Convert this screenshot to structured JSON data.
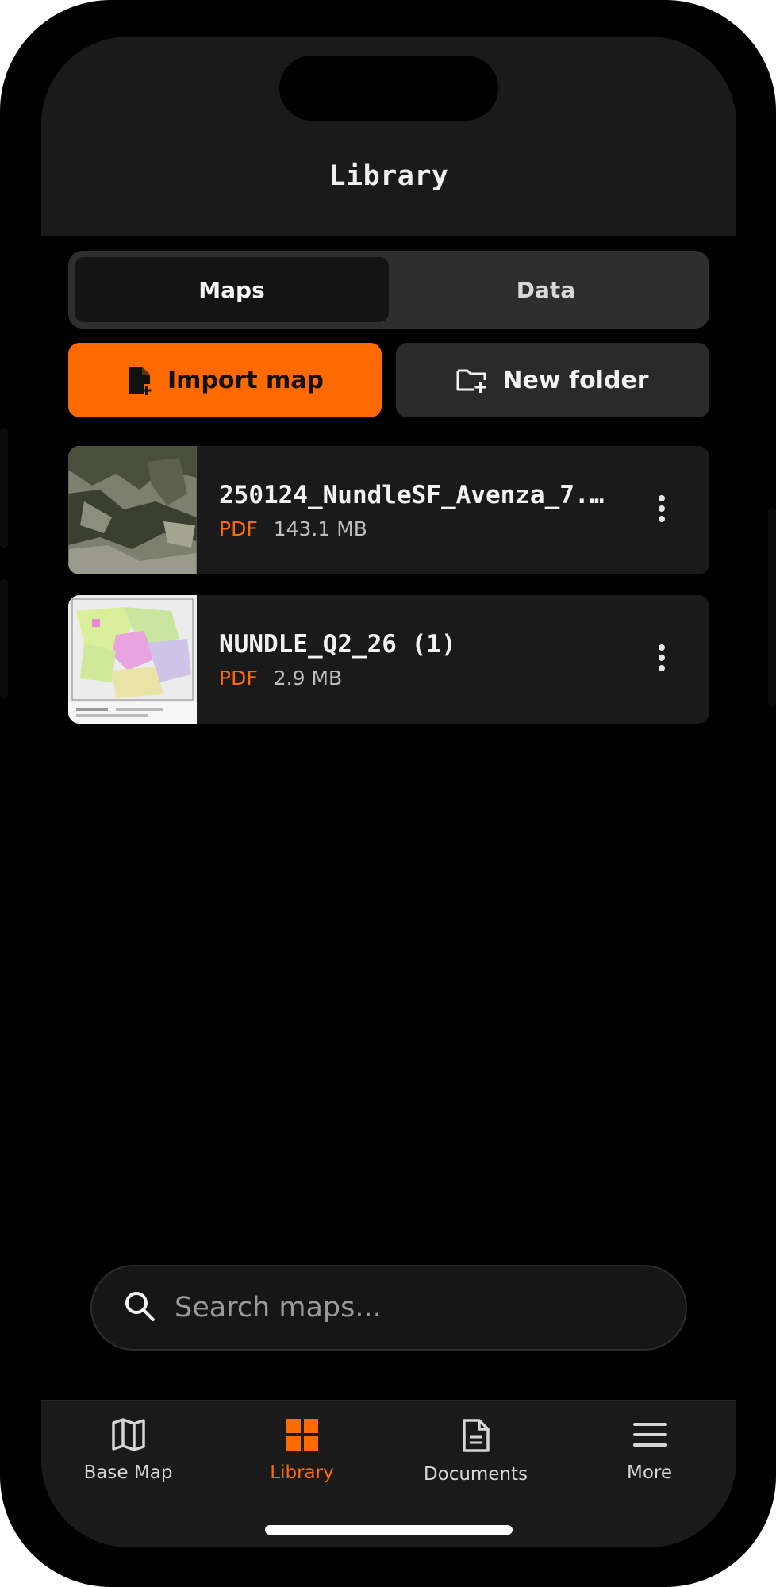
{
  "header": {
    "title": "Library"
  },
  "segments": [
    {
      "label": "Maps",
      "active": true
    },
    {
      "label": "Data",
      "active": false
    }
  ],
  "actions": {
    "import_label": "Import map",
    "new_folder_label": "New folder"
  },
  "maps": [
    {
      "name": "250124_NundleSF_Avenza_7...",
      "type": "PDF",
      "size": "143.1 MB",
      "thumbnail": "satellite-map-thumbnail"
    },
    {
      "name": "NUNDLE_Q2_26 (1)",
      "type": "PDF",
      "size": "2.9 MB",
      "thumbnail": "color-zoned-map-thumbnail"
    }
  ],
  "search": {
    "placeholder": "Search maps..."
  },
  "tabbar": [
    {
      "label": "Base Map",
      "icon": "map-icon",
      "active": false
    },
    {
      "label": "Library",
      "icon": "grid-icon",
      "active": true
    },
    {
      "label": "Documents",
      "icon": "document-icon",
      "active": false
    },
    {
      "label": "More",
      "icon": "menu-icon",
      "active": false
    }
  ],
  "colors": {
    "accent": "#ff6a00",
    "background": "#000000",
    "surface": "#1a1a1a",
    "surface_alt": "#2a2a2a"
  }
}
